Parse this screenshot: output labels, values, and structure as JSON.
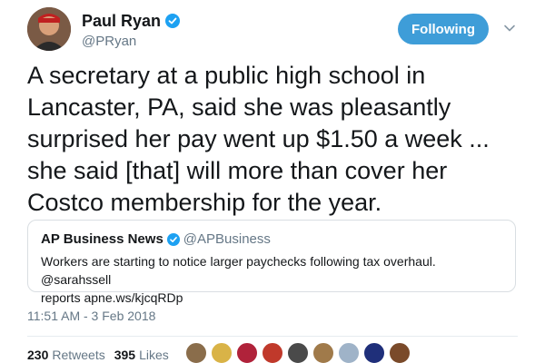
{
  "author": {
    "display_name": "Paul Ryan",
    "handle": "@PRyan",
    "verified_icon": "verified-badge-icon"
  },
  "follow_button": {
    "label": "Following",
    "color": "#3e9dd8"
  },
  "tweet": {
    "text": "A secretary at a public high school in\nLancaster, PA, said she was pleasantly\nsurprised her pay went up $1.50 a week ...\nshe said [that] will more than cover her\nCostco membership for the year."
  },
  "quoted_tweet": {
    "name": "AP Business News",
    "handle": "@APBusiness",
    "text": "Workers are starting to notice larger paychecks following tax overhaul. @sarahssell\nreports apne.ws/kjcqRDp"
  },
  "timestamp": "11:51 AM - 3 Feb 2018",
  "stats": {
    "retweets_count": "230",
    "retweets_label": "Retweets",
    "likes_count": "395",
    "likes_label": "Likes"
  },
  "liker_avatars": [
    {
      "color": "#8a6d4b"
    },
    {
      "color": "#d9b347"
    },
    {
      "color": "#b0223a"
    },
    {
      "color": "#c0392b"
    },
    {
      "color": "#4a4a4a"
    },
    {
      "color": "#a07a4a"
    },
    {
      "color": "#9fb3c8"
    },
    {
      "color": "#1f2f7a"
    },
    {
      "color": "#7a4a2a"
    }
  ],
  "colors": {
    "accent": "#3e9dd8",
    "secondary_text": "#657786"
  }
}
